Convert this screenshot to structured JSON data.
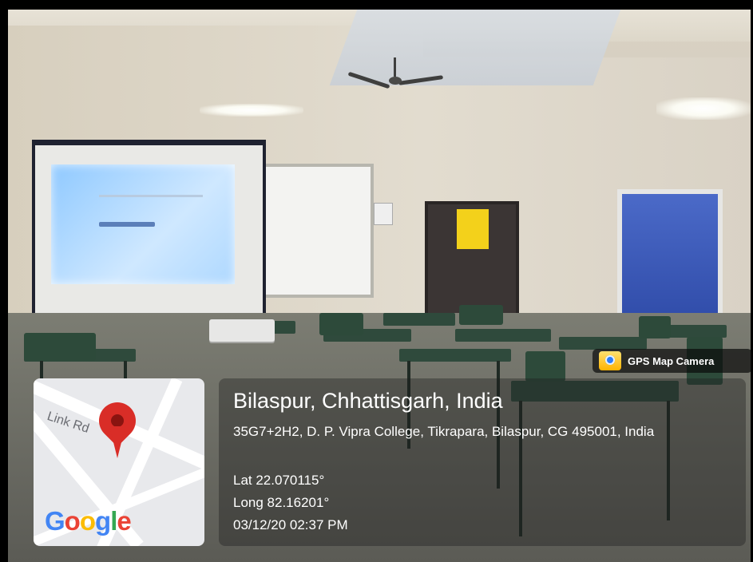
{
  "overlay": {
    "app": "GPS Map Camera",
    "location": "Bilaspur, Chhattisgarh, India",
    "address": "35G7+2H2, D. P. Vipra College, Tikrapara, Bilaspur, CG 495001, India",
    "latitude": "Lat 22.070115°",
    "longitude": "Long 82.16201°",
    "timestamp": "03/12/20 02:37 PM"
  },
  "map": {
    "street_label": "Link Rd",
    "brand": [
      "G",
      "o",
      "o",
      "g",
      "l",
      "e"
    ]
  },
  "colors": {
    "google_blue": "#4285f4",
    "google_red": "#ea4335",
    "google_yellow": "#fbbc05",
    "google_green": "#34a853",
    "pin_red": "#d92d27"
  },
  "icons": {
    "map_pin": "map-pin-icon",
    "brand_icon": "gps-map-camera-icon"
  }
}
